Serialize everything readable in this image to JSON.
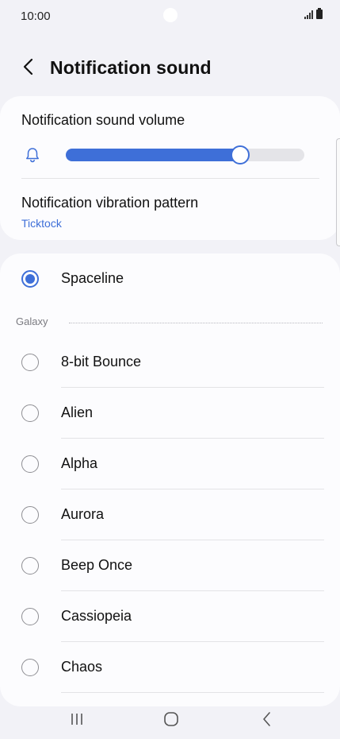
{
  "status_bar": {
    "time": "10:00"
  },
  "header": {
    "title": "Notification sound"
  },
  "volume": {
    "label": "Notification sound volume",
    "level": 0.73
  },
  "vibration": {
    "label": "Notification vibration pattern",
    "value": "Ticktock"
  },
  "selected_sound": {
    "label": "Spaceline"
  },
  "group": {
    "label": "Galaxy"
  },
  "sounds": [
    {
      "label": "8-bit Bounce"
    },
    {
      "label": "Alien"
    },
    {
      "label": "Alpha"
    },
    {
      "label": "Aurora"
    },
    {
      "label": "Beep Once"
    },
    {
      "label": "Cassiopeia"
    },
    {
      "label": "Chaos"
    }
  ],
  "colors": {
    "accent": "#3e6fd8",
    "background": "#f2f2f7",
    "card": "#fcfcfe"
  },
  "icons": {
    "back": "chevron-left-icon",
    "bell": "bell-icon",
    "recents": "recent-apps-icon",
    "home": "home-icon",
    "nav_back": "back-icon"
  }
}
